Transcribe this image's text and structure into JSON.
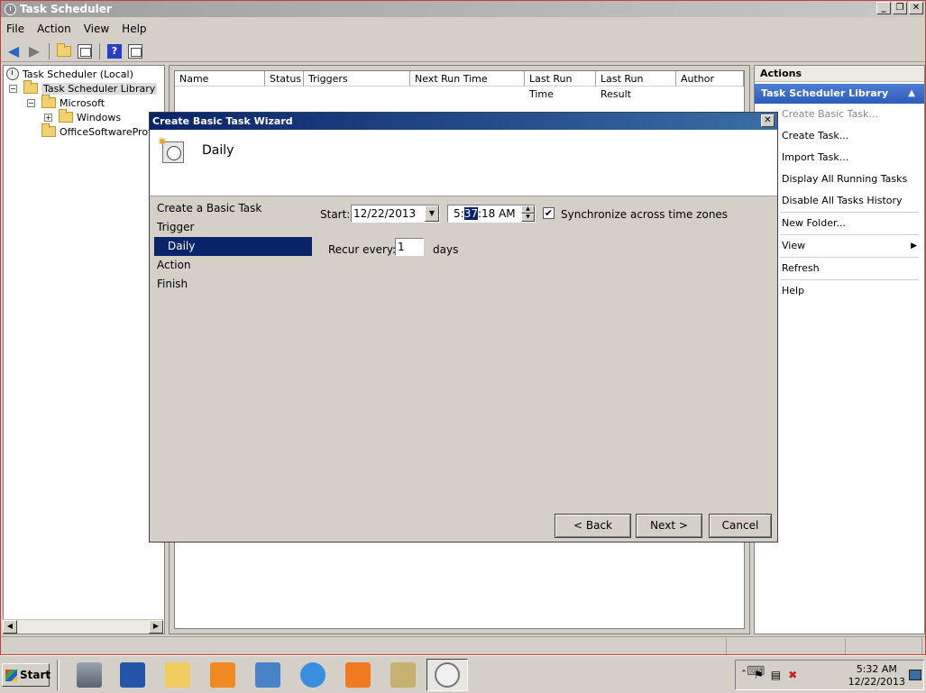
{
  "window": {
    "title": "Task Scheduler",
    "controls": [
      "_",
      "❐",
      "✕"
    ]
  },
  "menu": [
    "File",
    "Action",
    "View",
    "Help"
  ],
  "tree": {
    "root": "Task Scheduler (Local)",
    "library": "Task Scheduler Library",
    "microsoft": "Microsoft",
    "windows": "Windows",
    "office": "OfficeSoftwareProte"
  },
  "list": {
    "columns": [
      "Name",
      "Status",
      "Triggers",
      "Next Run Time",
      "Last Run Time",
      "Last Run Result",
      "Author"
    ]
  },
  "actions": {
    "title": "Actions",
    "section": "Task Scheduler Library",
    "items": [
      {
        "label": "Create Basic Task...",
        "disabled": true
      },
      {
        "label": "Create Task..."
      },
      {
        "label": "Import Task..."
      },
      {
        "label": "Display All Running Tasks"
      },
      {
        "label": "Disable All Tasks History"
      },
      {
        "label": "New Folder..."
      },
      {
        "label": "View"
      },
      {
        "label": "Refresh"
      },
      {
        "label": "Help"
      }
    ]
  },
  "dialog": {
    "title": "Create Basic Task Wizard",
    "close": "✕",
    "header": "Daily",
    "steps": [
      "Create a Basic Task",
      "Trigger",
      "Daily",
      "Action",
      "Finish"
    ],
    "start_label": "Start:",
    "start_date": "12/22/2013",
    "start_time_pre": "5:",
    "start_time_sel": "37",
    "start_time_post": ":18 AM",
    "sync_label": "Synchronize across time zones",
    "sync_checked": "✔",
    "recur_label": "Recur every:",
    "recur_value": "1",
    "recur_unit": "days",
    "back": "< Back",
    "next": "Next >",
    "cancel": "Cancel"
  },
  "taskbar": {
    "start": "Start",
    "clock_time": "5:32 AM",
    "clock_date": "12/22/2013"
  }
}
